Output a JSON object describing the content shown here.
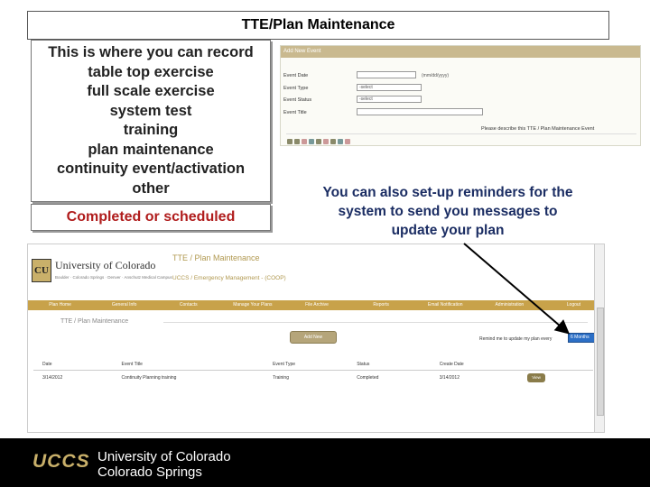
{
  "slide": {
    "title": "TTE/Plan Maintenance",
    "description_lines": [
      "This is where you can record",
      "table top exercise",
      "full scale exercise",
      "system test",
      "training",
      "plan maintenance",
      "continuity event/activation",
      "other"
    ],
    "status_note": "Completed or scheduled",
    "reminder_note": "You can also set-up reminders for the system to send you messages to update your plan"
  },
  "add_form": {
    "header": "Add New Event",
    "rows": [
      {
        "label": "Event Date",
        "value": "",
        "note": "(mm/dd/yyyy)"
      },
      {
        "label": "Event Type",
        "value": "-select"
      },
      {
        "label": "Event Status",
        "value": "-select"
      },
      {
        "label": "Event Title",
        "value": ""
      }
    ],
    "description_label": "Please describe this TTE / Plan Maintenance Event"
  },
  "app": {
    "logo_text": "CU",
    "org_name": "University of Colorado",
    "org_sub": "Boulder · Colorado Springs · Denver · Anschutz Medical Campus",
    "title": "TTE / Plan Maintenance",
    "subtitle": "UCCS / Emergency Management - (COOP)",
    "nav": [
      "Plan Home",
      "General Info",
      "Contacts",
      "Manage Your Plans",
      "File Archive",
      "Reports",
      "Email Notification",
      "Administration",
      "Logout"
    ],
    "page_heading": "TTE / Plan Maintenance",
    "add_new_label": "Add New",
    "remind_label": "Remind me to update my plan every",
    "remind_value": "6 Months",
    "table": {
      "headers": [
        "Date",
        "Event Title",
        "Event Type",
        "Status",
        "Create Date",
        ""
      ],
      "rows": [
        [
          "3/14/2012",
          "Continuity Planning training",
          "Training",
          "Completed",
          "3/14/2012",
          "View"
        ]
      ]
    }
  },
  "footer": {
    "logo": "UCCS",
    "line1": "University of Colorado",
    "line2": "Colorado Springs"
  },
  "colors": {
    "gold": "#c8a24a",
    "accent_blue": "#1b2d63",
    "status_red": "#b01c1c",
    "footer_bg": "#000000"
  }
}
